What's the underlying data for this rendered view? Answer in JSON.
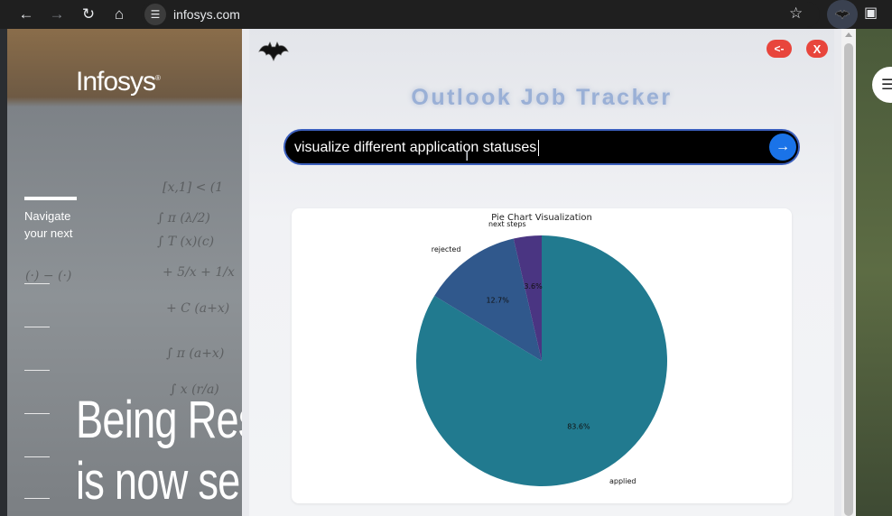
{
  "browser": {
    "url": "infosys.com",
    "icons": [
      "back-icon",
      "forward-icon",
      "reload-icon",
      "home-icon",
      "site-info-icon",
      "bookmark-star-icon",
      "extension-icon",
      "extensions-puzzle-icon"
    ]
  },
  "background_page": {
    "brand": "Infosys",
    "nav_text": "Navigate your next",
    "hero_line1": "Being Resi",
    "hero_line2": "is now ser"
  },
  "popup": {
    "back_label": "<-",
    "close_label": "X",
    "title": "Outlook Job Tracker",
    "search_value": "visualize different application statuses",
    "send_icon": "→",
    "colors": {
      "accent": "#1a73e8",
      "close": "#e8453c",
      "search_border": "#3b5fbd"
    }
  },
  "chart_data": {
    "type": "pie",
    "title": "Pie Chart Visualization",
    "slices": [
      {
        "label": "applied",
        "value": 83.6,
        "pct_label": "83.6%",
        "color": "#217a8f"
      },
      {
        "label": "rejected",
        "value": 12.7,
        "pct_label": "12.7%",
        "color": "#30588c"
      },
      {
        "label": "next steps",
        "value": 3.6,
        "pct_label": "3.6%",
        "color": "#4a3582"
      }
    ]
  }
}
